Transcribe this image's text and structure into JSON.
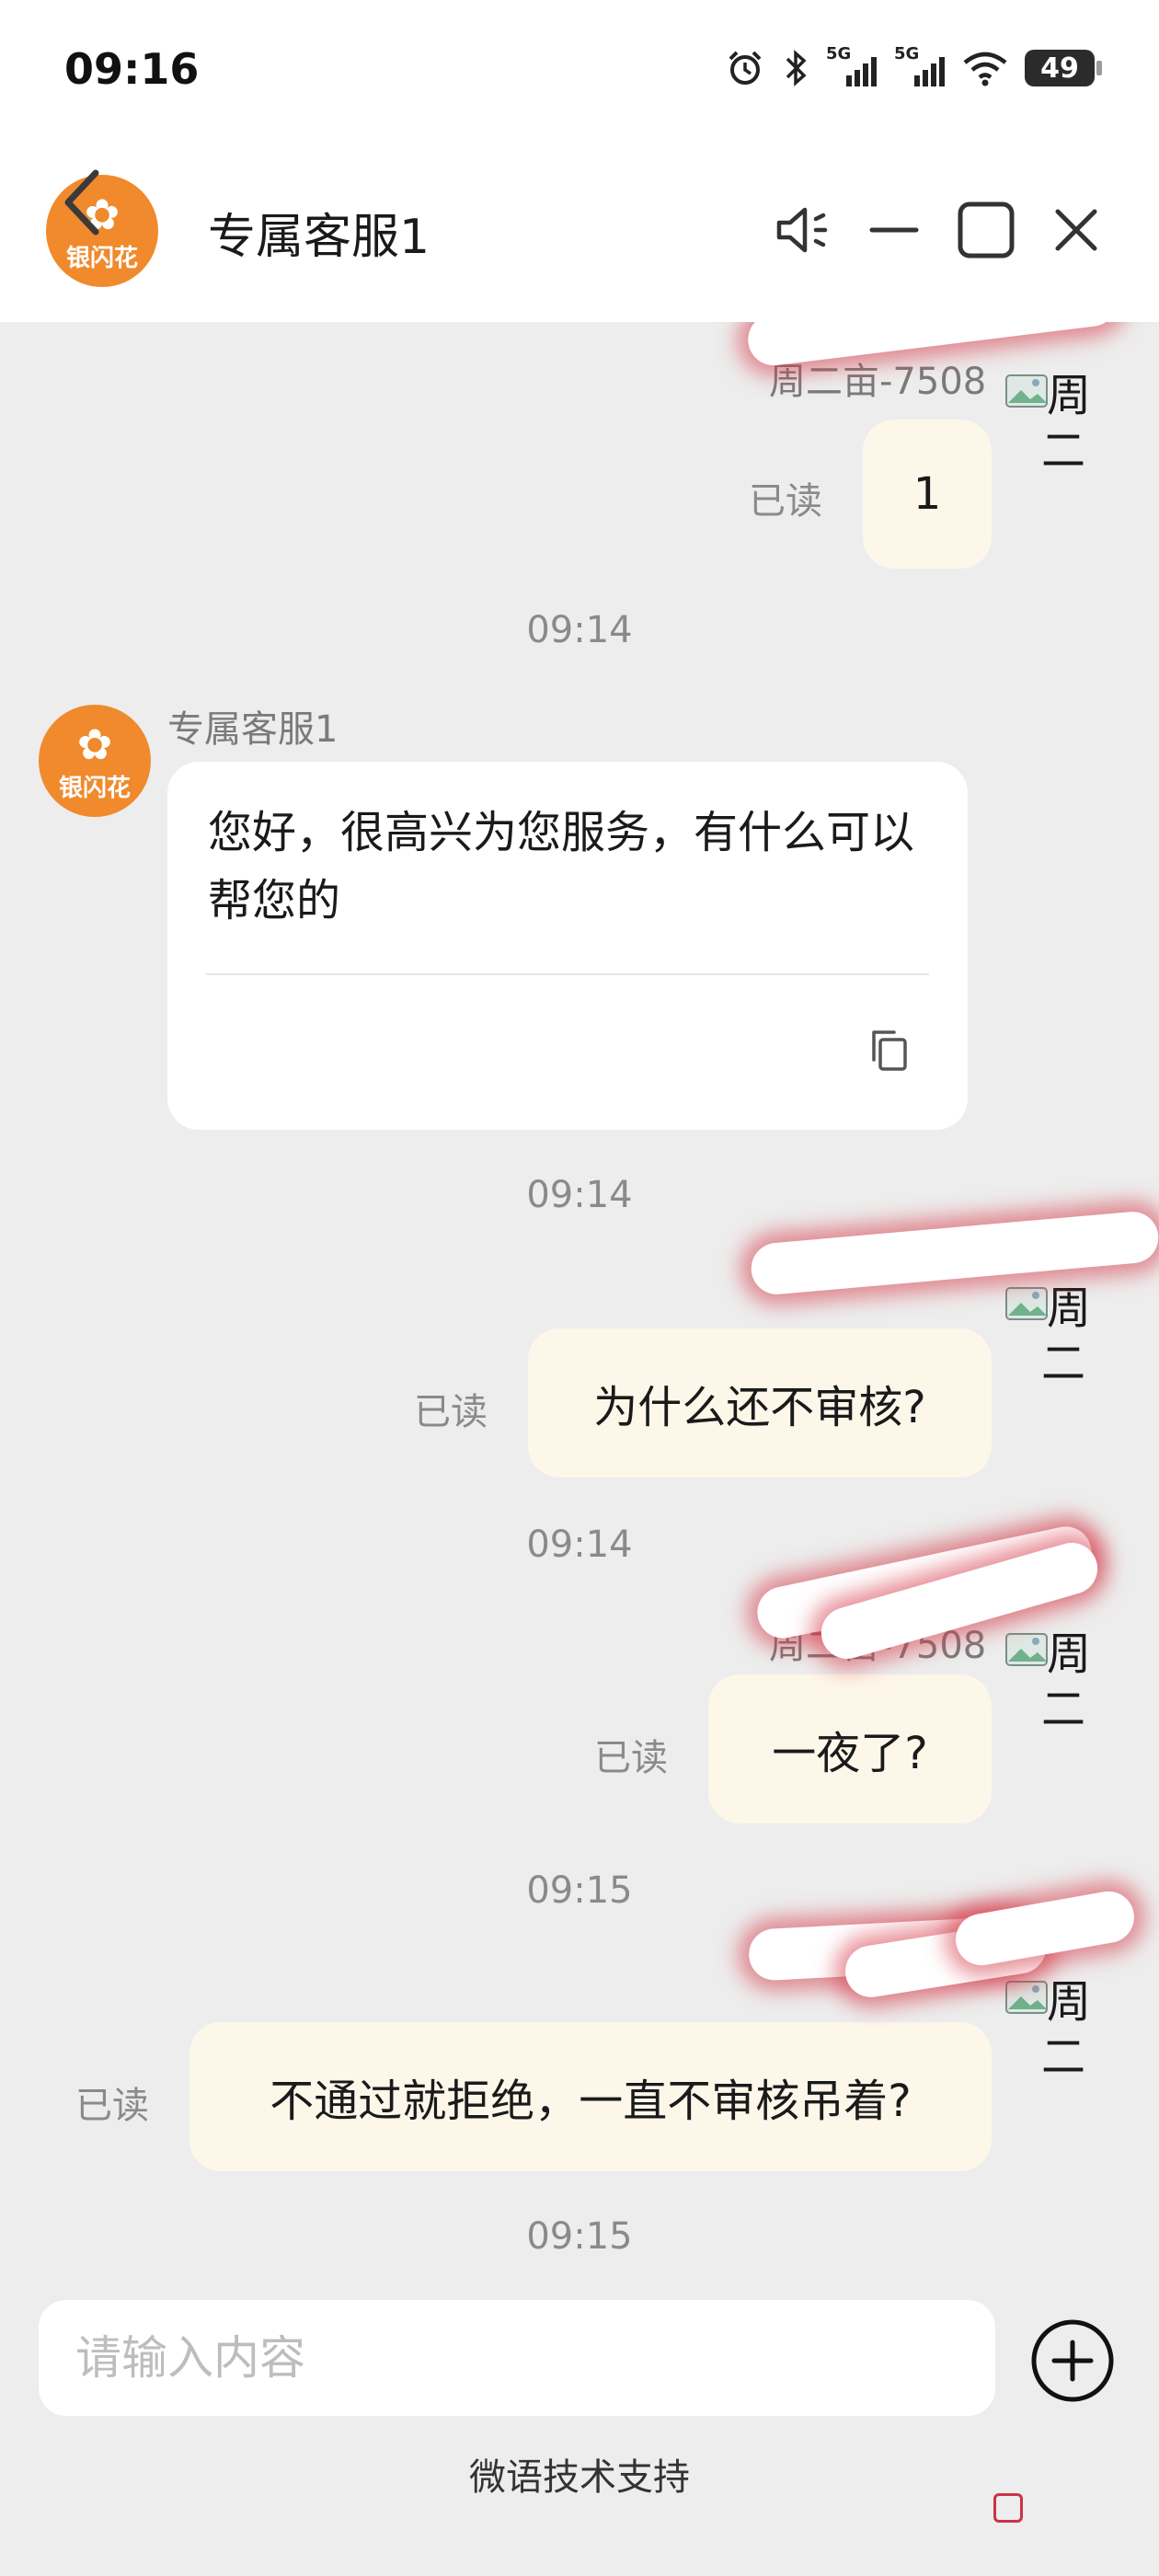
{
  "status_bar": {
    "time": "09:16",
    "signal_1": "5G",
    "signal_2": "5G",
    "battery": "49"
  },
  "header": {
    "title": "专属客服1",
    "avatar_text": "银闪花"
  },
  "messages": {
    "m1": {
      "sender": "周二亩-7508",
      "text": "1",
      "status": "已读"
    },
    "t1": "09:14",
    "agent": {
      "name": "专属客服1",
      "avatar_text": "银闪花",
      "text": "您好，很高兴为您服务，有什么可以帮您的"
    },
    "t2": "09:14",
    "m2": {
      "text": "为什么还不审核?",
      "status": "已读"
    },
    "t3": "09:14",
    "m3": {
      "sender": "周二亩-7508",
      "text": "一夜了?",
      "status": "已读"
    },
    "t4": "09:15",
    "m4": {
      "text": "不通过就拒绝，一直不审核吊着?",
      "status": "已读"
    },
    "t5": "09:15"
  },
  "user_avatar": {
    "line1": "周",
    "line2": "二"
  },
  "composer": {
    "placeholder": "请输入内容",
    "value": ""
  },
  "footer": {
    "support": "微语技术支持"
  },
  "colors": {
    "accent": "#f08a2c",
    "bubble_out": "#fdf7ea",
    "chat_bg": "#ededed",
    "scribble_glow": "#d63c4a"
  },
  "icons": {
    "back": "chevron-left-icon",
    "volume": "speaker-icon",
    "minimize": "minimize-icon",
    "maximize": "square-icon",
    "close": "close-icon",
    "copy": "copy-icon",
    "add": "plus-circle-icon"
  }
}
